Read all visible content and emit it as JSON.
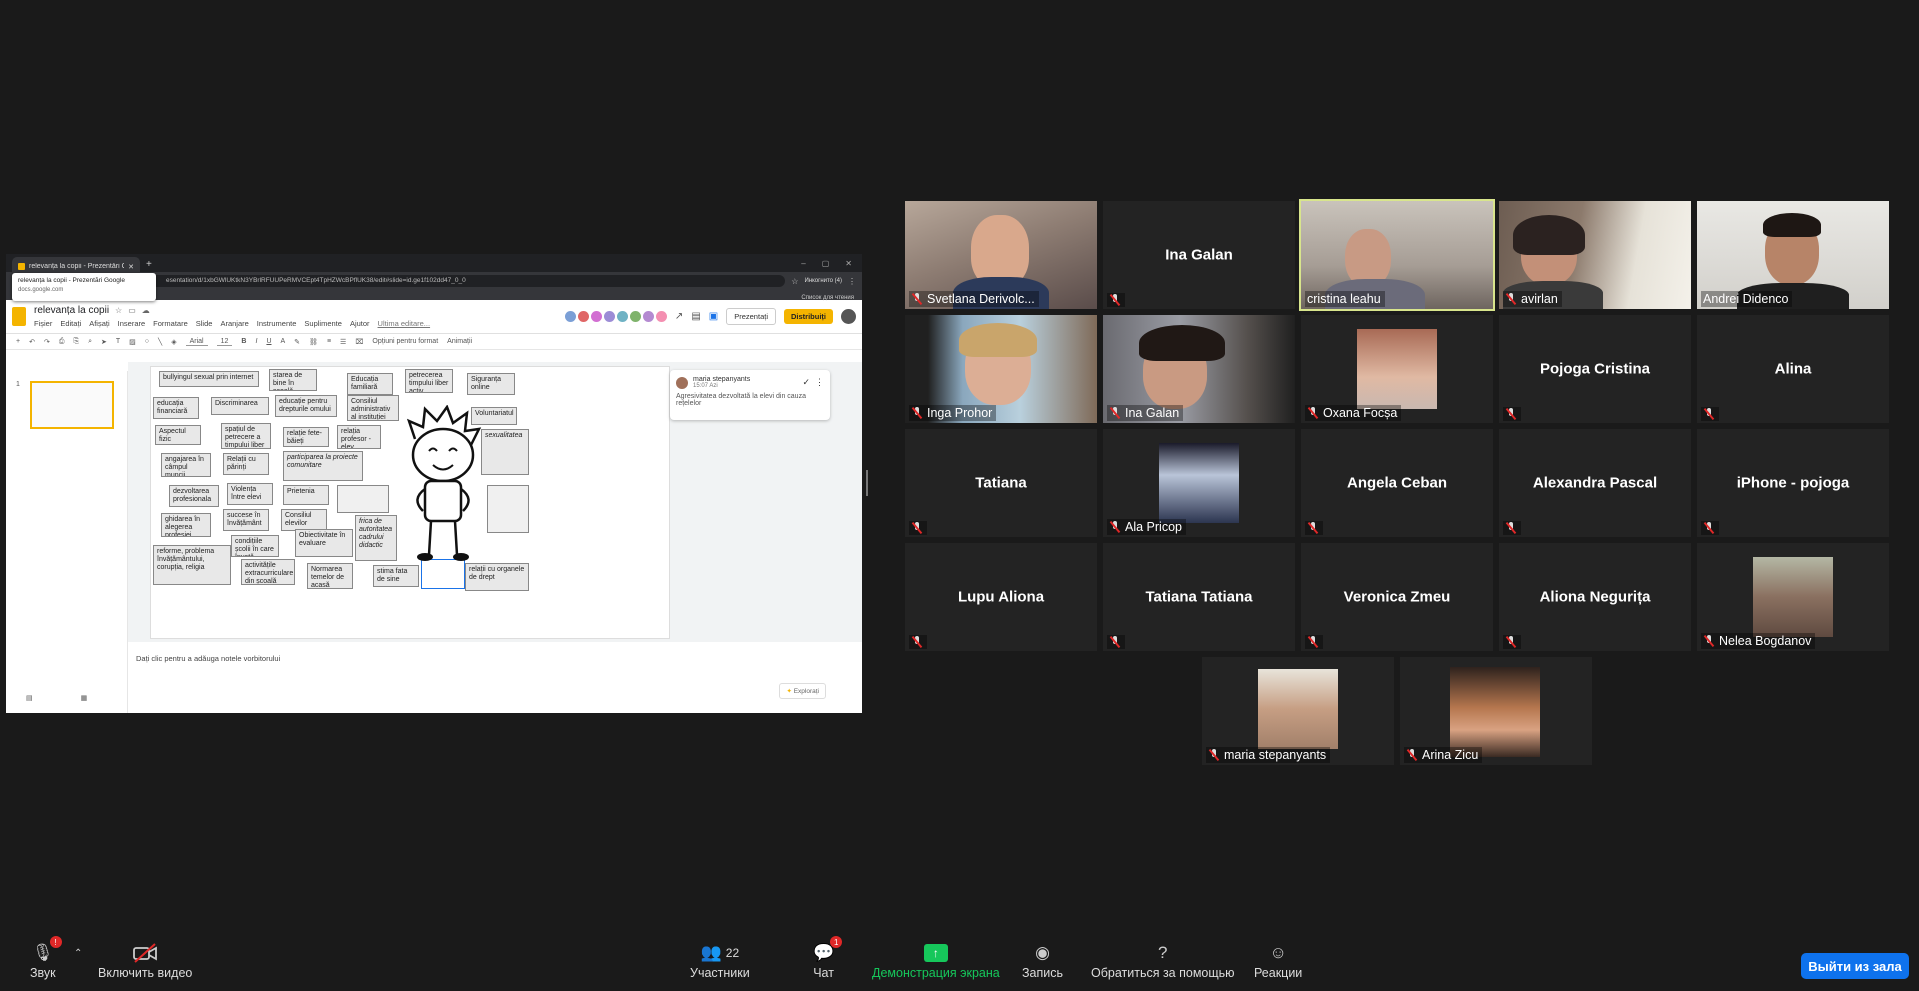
{
  "browser": {
    "tab_title": "relevanța la copii - Prezentări Go",
    "url": "esentation/d/1xbGWlUKtkN3YBrlRFUUPeRMVCEpt4TpHZWcBPflUK38/edit#slide=id.ge1f102dd47_0_0",
    "tooltip_title": "relevanța la copii - Prezentări Google",
    "tooltip_domain": "docs.google.com",
    "incognito": "Инкогнито (4)",
    "reading_list": "Список для чтения"
  },
  "slides": {
    "title": "relevanța la copii",
    "menus": [
      "Fișier",
      "Editați",
      "Afișați",
      "Inserare",
      "Formatare",
      "Slide",
      "Aranjare",
      "Instrumente",
      "Suplimente",
      "Ajutor"
    ],
    "last_edit": "Ultima editare...",
    "present": "Prezentați",
    "share": "Distribuiți",
    "font": "Arial",
    "font_size": "12",
    "format_options": "Opțiuni pentru format",
    "animations": "Animații",
    "slide_number": "1",
    "notes_placeholder": "Dați clic pentru a adăuga notele vorbitorului",
    "explore": "Explorați",
    "boxes": [
      "bullyingul sexual prin internet",
      "starea de bine în școală",
      "Educația familiară",
      "petrecerea timpului liber activ",
      "Siguranța online",
      "educația financiară",
      "Discriminarea",
      "educație pentru drepturile omului",
      "Consiliul administrativ al instituției",
      "Voluntariatul",
      "Aspectul fizic",
      "spațiul de petrecere a timpului liber",
      "relație fete-băieți",
      "relația profesor - elev",
      "sexualitatea",
      "angajarea în câmpul muncii",
      "Relații cu părinți",
      "participarea la proiecte comunitare",
      "dezvoltarea profesionala",
      "Violența între elevi",
      "Prietenia",
      "ghidarea în alegerea profesiei",
      "succese în învățământ",
      "Consiliul elevilor",
      "frica de autoritatea cadrului didactic",
      "Obiectivitate în evaluare",
      "condițiile școlii în care învață",
      "reforme, problema învățământului, corupția, religia",
      "activitățile extracurriculare din școală",
      "Normarea temelor de acasă",
      "stima fata de sine",
      "relații cu organele de drept"
    ],
    "comment": {
      "author": "maria stepanyants",
      "time": "15:07 Azi",
      "text": "Agresivitatea dezvoltată la elevi din cauza rețelelor"
    }
  },
  "participants": [
    {
      "name": "Svetlana Derivolc...",
      "video": true
    },
    {
      "name": "Ina Galan",
      "video": false
    },
    {
      "name": "cristina leahu",
      "video": true,
      "active": true
    },
    {
      "name": "avirlan",
      "video": true
    },
    {
      "name": "Andrei Didenco",
      "video": true
    },
    {
      "name": "Inga Prohor",
      "video": true
    },
    {
      "name": "Ina Galan",
      "video": true
    },
    {
      "name": "Oxana Focșa",
      "photo": true
    },
    {
      "name": "Pojoga Cristina",
      "video": false
    },
    {
      "name": "Alina",
      "video": false
    },
    {
      "name": "Tatiana",
      "video": false
    },
    {
      "name": "Ala Pricop",
      "photo": true
    },
    {
      "name": "Angela Ceban",
      "video": false
    },
    {
      "name": "Alexandra Pascal",
      "video": false
    },
    {
      "name": "iPhone - pojoga",
      "video": false
    },
    {
      "name": "Lupu Aliona",
      "video": false
    },
    {
      "name": "Tatiana Tatiana",
      "video": false
    },
    {
      "name": "Veronica Zmeu",
      "video": false
    },
    {
      "name": "Aliona Negurița",
      "video": false
    },
    {
      "name": "Nelea Bogdanov",
      "photo": true
    },
    {
      "name": "maria stepanyants",
      "photo": true
    },
    {
      "name": "Arina Zicu",
      "photo": true
    }
  ],
  "toolbar": {
    "audio": "Звук",
    "video": "Включить видео",
    "participants": "Участники",
    "participants_count": "22",
    "chat": "Чат",
    "chat_badge": "1",
    "share_screen": "Демонстрация экрана",
    "record": "Запись",
    "help": "Обратиться за помощью",
    "reactions": "Реакции",
    "leave": "Выйти из зала",
    "audio_badge": "!"
  },
  "colors": {
    "accent_green": "#16c75b",
    "leave_blue": "#0e72ed",
    "active_speaker": "#d8e58c",
    "slides_yellow": "#f4b400"
  }
}
